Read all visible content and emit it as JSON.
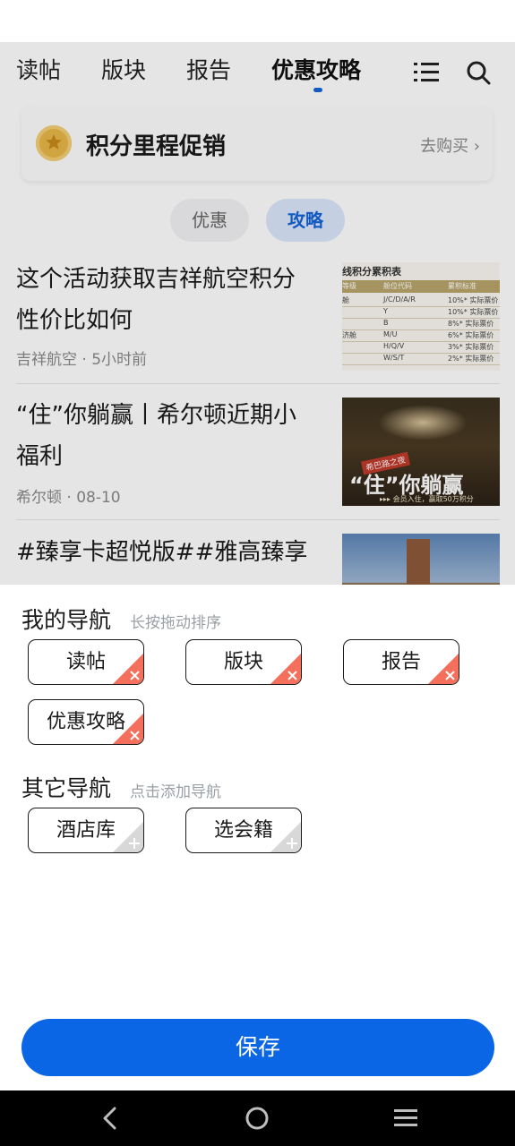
{
  "top_nav": {
    "tabs": [
      {
        "label": "读帖"
      },
      {
        "label": "版块"
      },
      {
        "label": "报告"
      },
      {
        "label": "优惠攻略",
        "active": true
      }
    ],
    "icons": [
      "list-icon",
      "search-icon"
    ],
    "accent_color": "#1565d8"
  },
  "promo_card": {
    "title": "积分里程促销",
    "link": "去购买 ›",
    "icon": "star-coin-icon"
  },
  "segment": {
    "options": [
      "优惠",
      "攻略"
    ],
    "selected": "攻略"
  },
  "articles": [
    {
      "title": "这个活动获取吉祥航空积分性价比如何",
      "source": "吉祥航空 · 5小时前",
      "thumb": {
        "heading": "线积分累积表",
        "columns": [
          "等级",
          "舱位代码",
          "累积标准"
        ],
        "rows": [
          [
            "舱",
            "J/C/D/A/R",
            "10%* 实际票价"
          ],
          [
            "",
            "Y",
            "10%* 实际票价"
          ],
          [
            "",
            "B",
            "8%* 实际票价"
          ],
          [
            "济舱",
            "M/U",
            "6%* 实际票价"
          ],
          [
            "",
            "H/Q/V",
            "3%* 实际票价"
          ],
          [
            "",
            "W/S/T",
            "2%* 实际票价"
          ]
        ]
      }
    },
    {
      "title": "“住”你躺赢丨希尔顿近期小福利",
      "source": "希尔顿 · 08-10",
      "thumb": {
        "tag": "希巴路之夜",
        "headline": "“住”你躺赢",
        "sub": "▸▸▸ 会员入住，赢取50万积分"
      }
    },
    {
      "title": "#臻享卡超悦版##雅高臻享",
      "source": ""
    }
  ],
  "sheet": {
    "my_nav": {
      "title": "我的导航",
      "hint": "长按拖动排序",
      "items": [
        "读帖",
        "版块",
        "报告",
        "优惠攻略"
      ]
    },
    "other_nav": {
      "title": "其它导航",
      "hint": "点击添加导航",
      "items": [
        "酒店库",
        "选会籍"
      ]
    },
    "save_label": "保存",
    "save_color": "#0a66e4",
    "remove_color": "#f4705c"
  },
  "system_nav": [
    "back-icon",
    "home-icon",
    "recents-icon"
  ]
}
